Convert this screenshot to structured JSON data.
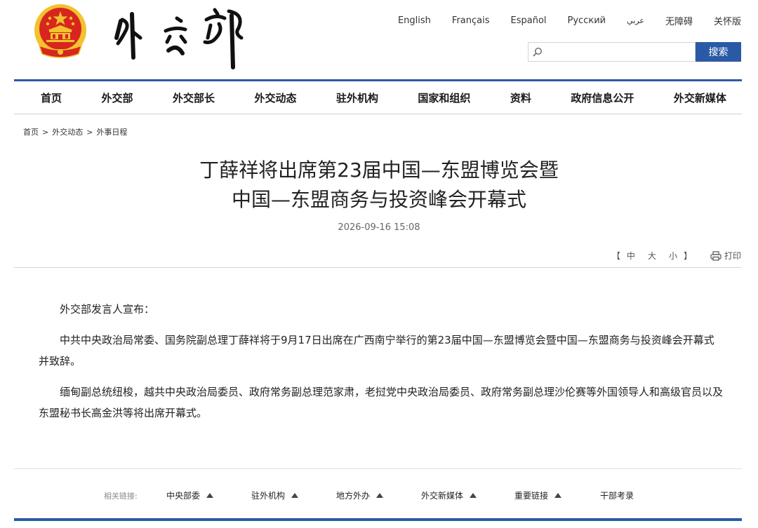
{
  "languages": [
    "English",
    "Français",
    "Español",
    "Русский",
    "عربي",
    "无障碍",
    "关怀版"
  ],
  "search": {
    "placeholder": "",
    "button_label": "搜索"
  },
  "nav": [
    "首页",
    "外交部",
    "外交部长",
    "外交动态",
    "驻外机构",
    "国家和组织",
    "资料",
    "政府信息公开",
    "外交新媒体"
  ],
  "breadcrumb": {
    "items": [
      "首页",
      "外交动态",
      "外事日程"
    ],
    "separator": ">"
  },
  "article": {
    "title_line1": "丁薛祥将出席第23届中国—东盟博览会暨",
    "title_line2": "中国—东盟商务与投资峰会开幕式",
    "date": "2026-09-16 15:08",
    "paragraphs": [
      "外交部发言人宣布：",
      "中共中央政治局常委、国务院副总理丁薛祥将于9月17日出席在广西南宁举行的第23届中国—东盟博览会暨中国—东盟商务与投资峰会开幕式并致辞。",
      "缅甸副总统纽梭，越共中央政治局委员、政府常务副总理范家肃，老挝党中央政治局委员、政府常务副总理沙伦赛等外国领导人和高级官员以及东盟秘书长高金洪等将出席开幕式。"
    ]
  },
  "tools": {
    "open_bracket": "【",
    "close_bracket": "】",
    "sizes": [
      "中",
      "大",
      "小"
    ],
    "print_label": "打印"
  },
  "related": {
    "label": "相关链接:",
    "items": [
      "中央部委",
      "驻外机构",
      "地方外办",
      "外交新媒体",
      "重要链接",
      "干部考录"
    ]
  },
  "colors": {
    "accent": "#2a5aa5",
    "emblem_red": "#d7261e",
    "emblem_gold": "#f2c230"
  },
  "icons": [
    "search-icon",
    "print-icon",
    "triangle-up-icon",
    "national-emblem",
    "mfa-calligraphy-logo"
  ]
}
